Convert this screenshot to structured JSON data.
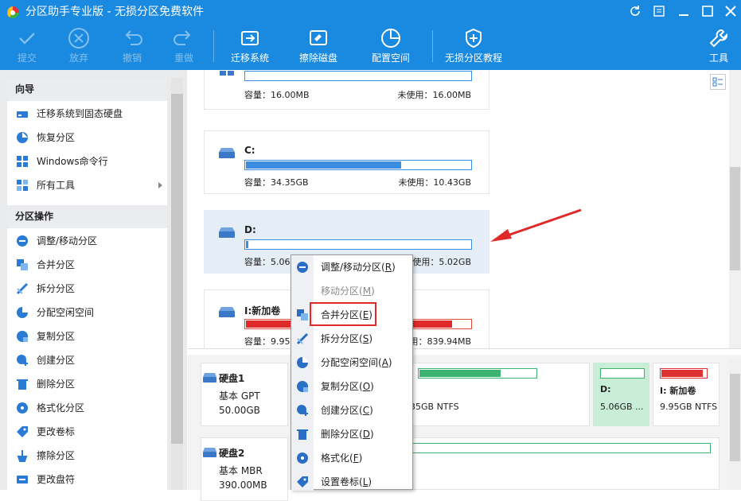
{
  "app": {
    "title": "分区助手专业版 - 无损分区免费软件"
  },
  "toolbar": {
    "items": [
      {
        "label": "提交",
        "icon": "check-icon",
        "enabled": false
      },
      {
        "label": "放弃",
        "icon": "cancel-circle-icon",
        "enabled": false
      },
      {
        "label": "撤销",
        "icon": "undo-icon",
        "enabled": false
      },
      {
        "label": "重做",
        "icon": "redo-icon",
        "enabled": false
      },
      {
        "label": "迁移系统",
        "icon": "migrate-os-icon",
        "enabled": true
      },
      {
        "label": "擦除磁盘",
        "icon": "wipe-disk-icon",
        "enabled": true
      },
      {
        "label": "配置空间",
        "icon": "allocate-space-icon",
        "enabled": true
      },
      {
        "label": "无损分区教程",
        "icon": "shield-plus-icon",
        "enabled": true
      },
      {
        "label": "工具",
        "icon": "tools-icon",
        "enabled": true
      }
    ]
  },
  "sidebar": {
    "wizard_title": "向导",
    "wizard_items": [
      {
        "label": "迁移系统到固态硬盘",
        "icon": "migrate-ssd-icon"
      },
      {
        "label": "恢复分区",
        "icon": "recover-partition-icon"
      },
      {
        "label": "Windows命令行",
        "icon": "windows-icon"
      },
      {
        "label": "所有工具",
        "icon": "all-tools-icon"
      }
    ],
    "ops_title": "分区操作",
    "ops_items": [
      {
        "label": "调整/移动分区",
        "icon": "resize-icon"
      },
      {
        "label": "合并分区",
        "icon": "merge-icon"
      },
      {
        "label": "拆分分区",
        "icon": "split-icon"
      },
      {
        "label": "分配空闲空间",
        "icon": "allocate-icon"
      },
      {
        "label": "复制分区",
        "icon": "copy-icon"
      },
      {
        "label": "创建分区",
        "icon": "create-icon"
      },
      {
        "label": "删除分区",
        "icon": "delete-icon"
      },
      {
        "label": "格式化分区",
        "icon": "format-icon"
      },
      {
        "label": "更改卷标",
        "icon": "label-icon"
      },
      {
        "label": "擦除分区",
        "icon": "wipe-icon"
      },
      {
        "label": "更改盘符",
        "icon": "drive-letter-icon"
      }
    ]
  },
  "partitions": [
    {
      "name": "*:",
      "capacity": "容量：16.00MB",
      "free": "未使用：16.00MB",
      "used_fraction": 0.0,
      "color": "#3a8de0",
      "icon": "windows-icon"
    },
    {
      "name": "C:",
      "capacity": "容量：34.35GB",
      "free": "未使用：10.43GB",
      "used_fraction": 0.69,
      "color": "#3a8de0",
      "icon": "drive-icon"
    },
    {
      "name": "D:",
      "capacity": "容量：5.06(",
      "free": "未使用：5.02GB",
      "used_fraction": 0.01,
      "color": "#3a8de0",
      "icon": "drive-icon"
    },
    {
      "name": "I:新加卷",
      "capacity": "容量：9.95",
      "free": "未使用：839.94MB",
      "used_fraction": 0.92,
      "color": "#e02a2a",
      "icon": "drive-icon"
    }
  ],
  "disks": [
    {
      "name": "硬盘1",
      "type": "基本 GPT",
      "size": "50.00GB",
      "partitions": [
        {
          "label": "",
          "size": "35GB NTFS",
          "used_fraction": 0.7,
          "color": "#3cb371"
        },
        {
          "label": "D:",
          "size": "5.06GB ...",
          "used_fraction": 0.0,
          "color": "#3cb371"
        },
        {
          "label": "I: 新加卷",
          "size": "9.95GB NTFS",
          "used_fraction": 0.92,
          "color": "#d33"
        }
      ]
    },
    {
      "name": "硬盘2",
      "type": "基本 MBR",
      "size": "390.00MB",
      "partitions": []
    }
  ],
  "context_menu": {
    "items": [
      {
        "label": "调整/移动分区",
        "key": "R",
        "enabled": true,
        "icon": "resize-icon"
      },
      {
        "label": "移动分区",
        "key": "M",
        "enabled": false,
        "icon": ""
      },
      {
        "label": "合并分区",
        "key": "E",
        "enabled": true,
        "icon": "merge-icon",
        "highlighted": true
      },
      {
        "label": "拆分分区",
        "key": "S",
        "enabled": true,
        "icon": "split-icon"
      },
      {
        "label": "分配空闲空间",
        "key": "A",
        "enabled": true,
        "icon": "allocate-icon"
      },
      {
        "label": "复制分区",
        "key": "O",
        "enabled": true,
        "icon": "copy-icon"
      },
      {
        "label": "创建分区",
        "key": "C",
        "enabled": true,
        "icon": "create-icon"
      },
      {
        "label": "删除分区",
        "key": "D",
        "enabled": true,
        "icon": "delete-icon"
      },
      {
        "label": "格式化",
        "key": "F",
        "enabled": true,
        "icon": "format-icon"
      },
      {
        "label": "设置卷标",
        "key": "L",
        "enabled": true,
        "icon": "label-icon"
      }
    ]
  }
}
